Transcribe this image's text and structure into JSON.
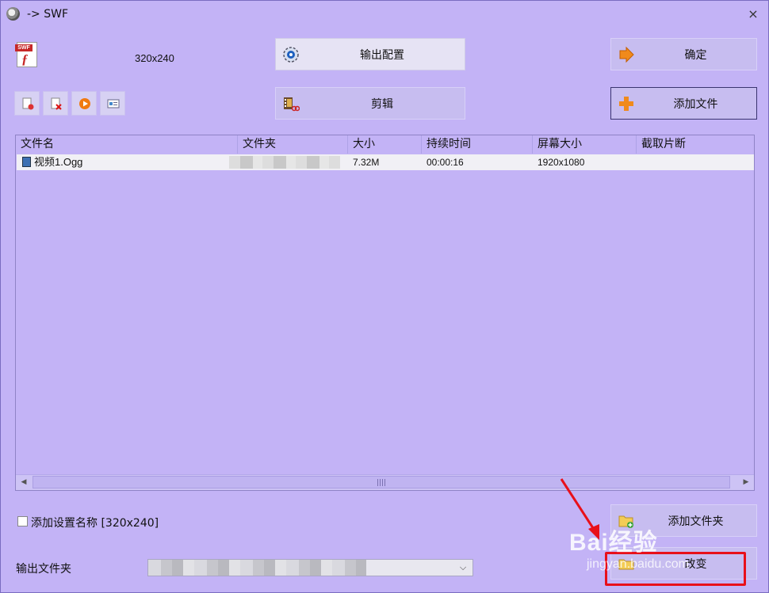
{
  "window": {
    "title": "-> SWF",
    "close_glyph": "×"
  },
  "header": {
    "format_icon": "swf-file-icon",
    "format_tag": "SWF",
    "resolution": "320x240"
  },
  "toolbar": {
    "output_config_label": "输出配置",
    "edit_label": "剪辑",
    "ok_label": "确定",
    "add_file_label": "添加文件",
    "small_buttons": [
      "new-doc-icon",
      "remove-icon",
      "play-icon",
      "info-icon"
    ]
  },
  "list": {
    "columns": [
      "文件名",
      "文件夹",
      "大小",
      "持续时间",
      "屏幕大小",
      "截取片断"
    ],
    "rows": [
      {
        "name": "视频1.Ogg",
        "folder": "",
        "size": "7.32M",
        "duration": "00:00:16",
        "screen": "1920x1080",
        "clip": ""
      }
    ]
  },
  "bottom": {
    "add_setting_name_label": "添加设置名称 [320x240]",
    "add_setting_checked": false,
    "add_folder_label": "添加文件夹",
    "output_folder_label": "输出文件夹",
    "change_label": "改变"
  },
  "watermark": {
    "logo_text": "Bai经验",
    "url": "jingyan.baidu.com"
  },
  "colors": {
    "background": "#c3b3f6",
    "highlight": "#e8101a"
  }
}
